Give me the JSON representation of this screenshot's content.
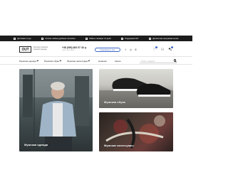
{
  "promos": [
    {
      "icon": "gift-icon",
      "text": "Доставка 1-3 дн"
    },
    {
      "icon": "card-icon",
      "text": "Оплата любым удобным способом"
    },
    {
      "icon": "return-icon",
      "text": "Обмен и возврат 14 дней"
    },
    {
      "icon": "chat-icon",
      "text": "Поддержка 24/7"
    },
    {
      "icon": "tag-icon",
      "text": "Дисконтная программа на все"
    }
  ],
  "header": {
    "logo": "OUT",
    "tagline": "Интернет-магазин мужской одежды",
    "phone": "+38 (093) 382 07 43",
    "hours": "Пн-Пт 9:00-19:00",
    "callback_label": "Перезвонить мне",
    "social": [
      {
        "icon": "facebook-icon",
        "glyph": "f"
      },
      {
        "icon": "instagram-icon",
        "glyph": "◎"
      },
      {
        "icon": "whatsapp-icon",
        "glyph": "✆"
      }
    ],
    "favorites_count": "0",
    "cart_count": "0"
  },
  "nav": {
    "items": [
      "Мужская одежда",
      "Мужская обувь",
      "Мужские аксессуары",
      "Новинки",
      "Акции"
    ],
    "search_placeholder": "Поиск товаров"
  },
  "categories": [
    {
      "label": "Мужская одежда"
    },
    {
      "label": "Мужская обувь"
    },
    {
      "label": "Мужские аксессуары"
    }
  ],
  "colors": {
    "accent": "#3b66c4",
    "topbar": "#1c1c1c"
  }
}
